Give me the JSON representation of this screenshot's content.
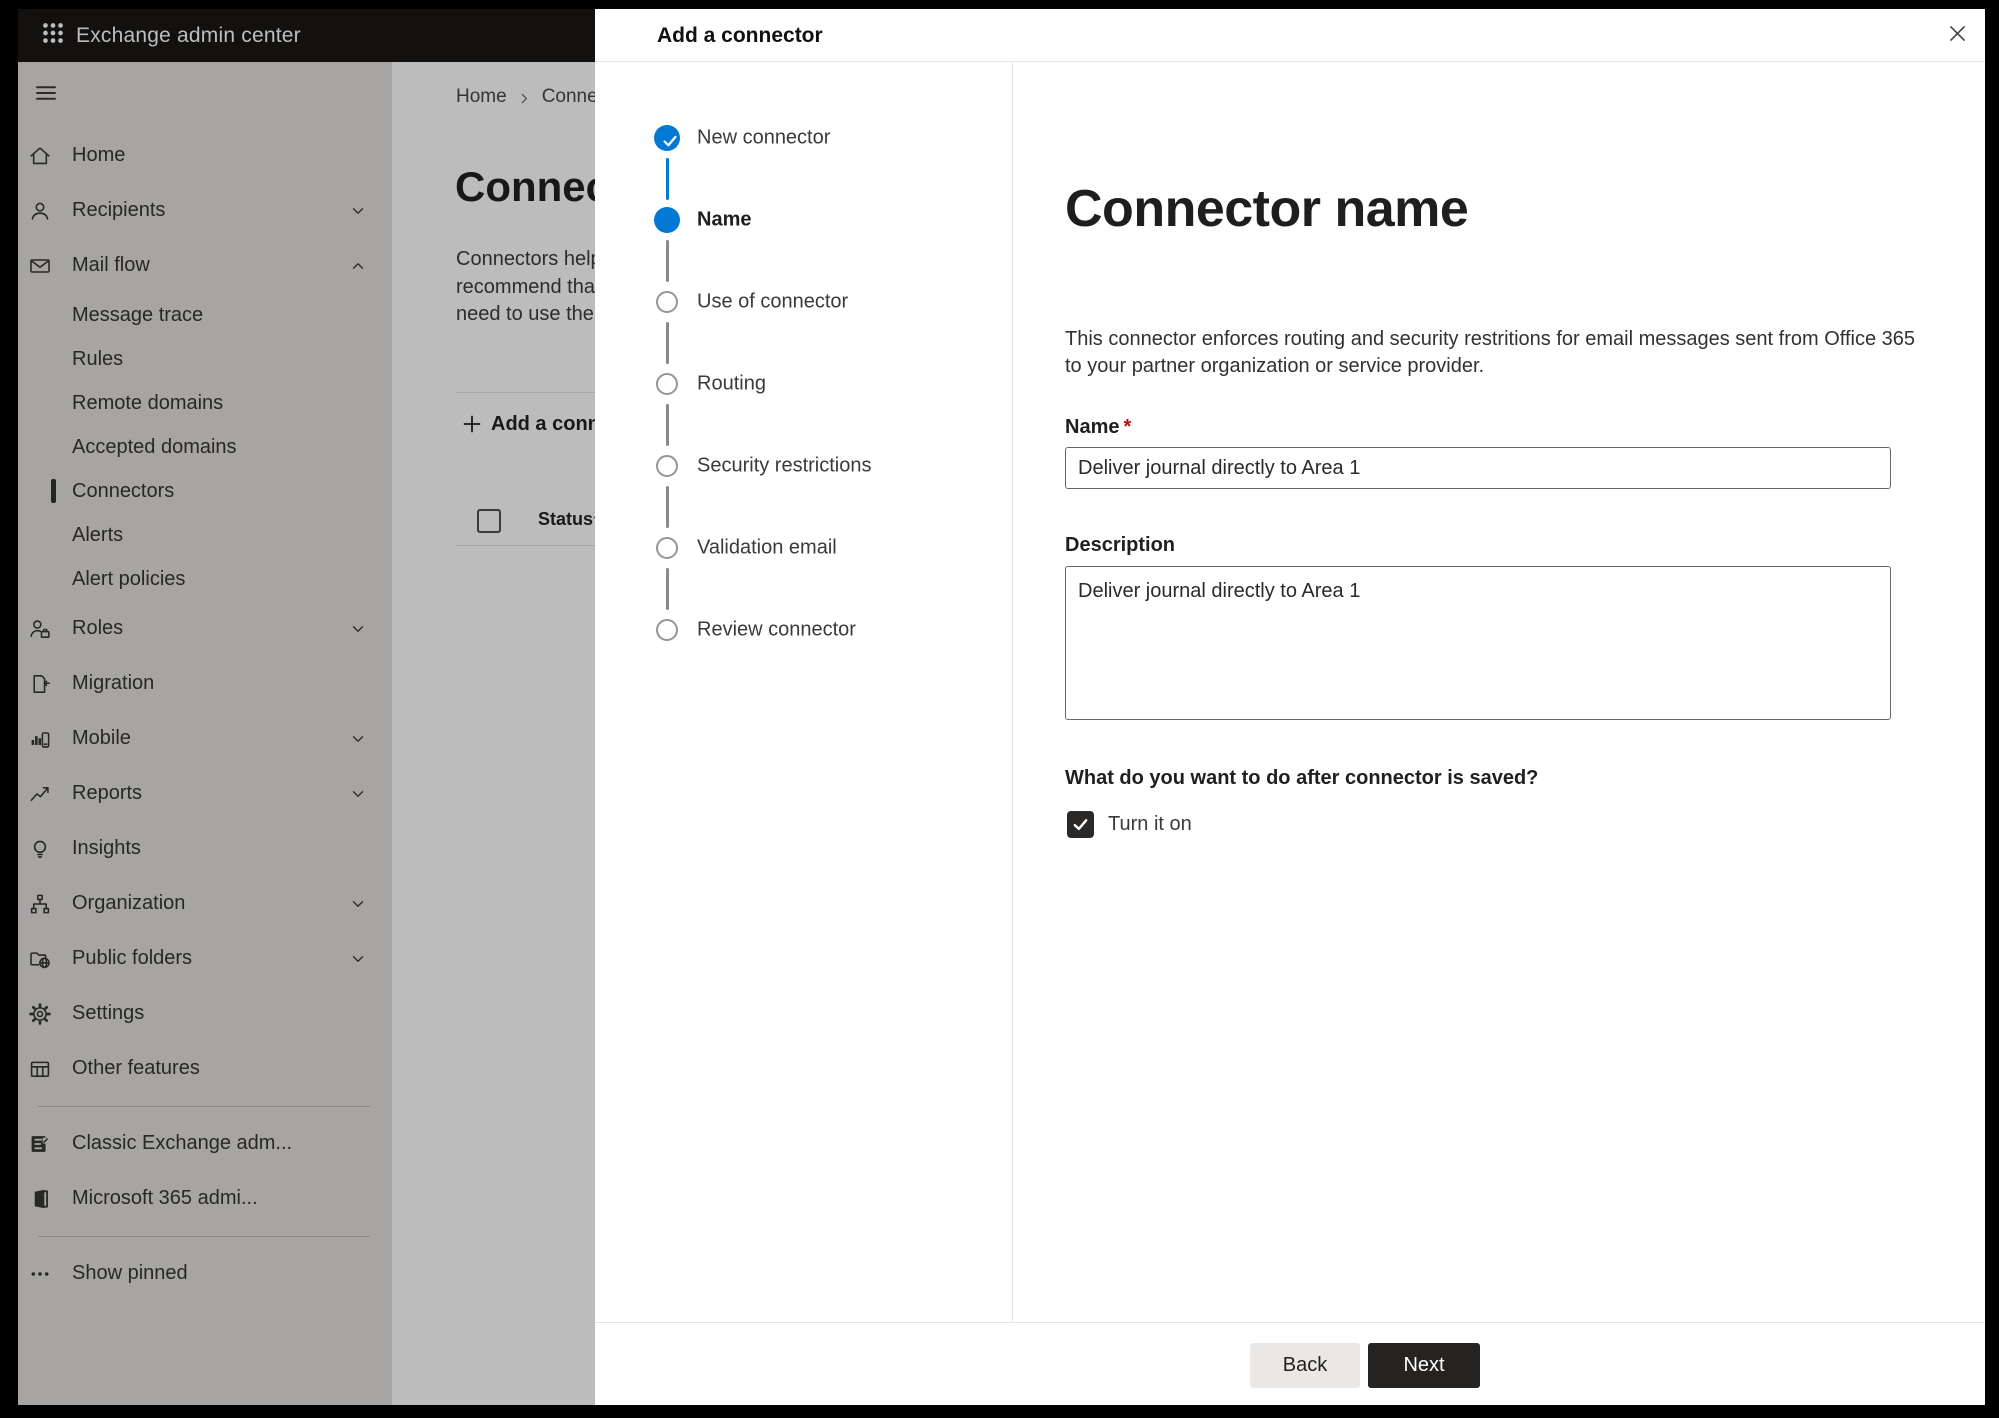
{
  "colors": {
    "accent": "#0078d4",
    "header_bg": "#161513",
    "primary_button_bg": "#252321",
    "required_mark": "#b10e1c"
  },
  "topbar": {
    "title": "Exchange admin center"
  },
  "sidebar": {
    "items": [
      {
        "type": "top",
        "icon": "home",
        "label": "Home"
      },
      {
        "type": "top",
        "icon": "person",
        "label": "Recipients",
        "chevron": "down"
      },
      {
        "type": "top",
        "icon": "mail",
        "label": "Mail flow",
        "chevron": "up"
      },
      {
        "type": "sub",
        "label": "Message trace"
      },
      {
        "type": "sub",
        "label": "Rules"
      },
      {
        "type": "sub",
        "label": "Remote domains"
      },
      {
        "type": "sub",
        "label": "Accepted domains"
      },
      {
        "type": "sub",
        "label": "Connectors",
        "selected": true
      },
      {
        "type": "sub",
        "label": "Alerts"
      },
      {
        "type": "sub",
        "label": "Alert policies"
      },
      {
        "type": "top",
        "icon": "roles",
        "label": "Roles",
        "chevron": "down"
      },
      {
        "type": "top",
        "icon": "migration",
        "label": "Migration"
      },
      {
        "type": "top",
        "icon": "mobile",
        "label": "Mobile",
        "chevron": "down"
      },
      {
        "type": "top",
        "icon": "reports",
        "label": "Reports",
        "chevron": "down"
      },
      {
        "type": "top",
        "icon": "insights",
        "label": "Insights"
      },
      {
        "type": "top",
        "icon": "organization",
        "label": "Organization",
        "chevron": "down"
      },
      {
        "type": "top",
        "icon": "public-folders",
        "label": "Public folders",
        "chevron": "down"
      },
      {
        "type": "top",
        "icon": "settings",
        "label": "Settings"
      },
      {
        "type": "top",
        "icon": "other-features",
        "label": "Other features"
      },
      {
        "type": "divider"
      },
      {
        "type": "top",
        "icon": "classic-exchange",
        "label": "Classic Exchange adm..."
      },
      {
        "type": "top",
        "icon": "m365",
        "label": "Microsoft 365 admi..."
      },
      {
        "type": "divider"
      },
      {
        "type": "top",
        "icon": "ellipsis",
        "label": "Show pinned"
      }
    ]
  },
  "page": {
    "breadcrumb": {
      "home": "Home",
      "current": "Conne"
    },
    "title": "Connect",
    "description_lines": [
      "Connectors help",
      "recommend that",
      "need to use ther"
    ],
    "add_button_label": "Add a conne",
    "table": {
      "status_header": "Status"
    }
  },
  "modal": {
    "title": "Add a connector",
    "steps": [
      {
        "label": "New connector",
        "state": "done"
      },
      {
        "label": "Name",
        "state": "current"
      },
      {
        "label": "Use of connector",
        "state": "todo"
      },
      {
        "label": "Routing",
        "state": "todo"
      },
      {
        "label": "Security restrictions",
        "state": "todo"
      },
      {
        "label": "Validation email",
        "state": "todo"
      },
      {
        "label": "Review connector",
        "state": "todo"
      }
    ],
    "content": {
      "heading": "Connector name",
      "description_lines": [
        "This connector enforces routing and security restritions for email messages sent from Office 365",
        "to your partner organization or service provider."
      ],
      "name_label": "Name",
      "required_mark": "*",
      "name_value": "Deliver journal directly to Area 1",
      "description_label": "Description",
      "description_value": "Deliver journal directly to Area 1",
      "after_save_question": "What do you want to do after connector is saved?",
      "turn_on_label": "Turn it on",
      "turn_on_checked": true
    },
    "footer": {
      "back_label": "Back",
      "next_label": "Next"
    }
  }
}
